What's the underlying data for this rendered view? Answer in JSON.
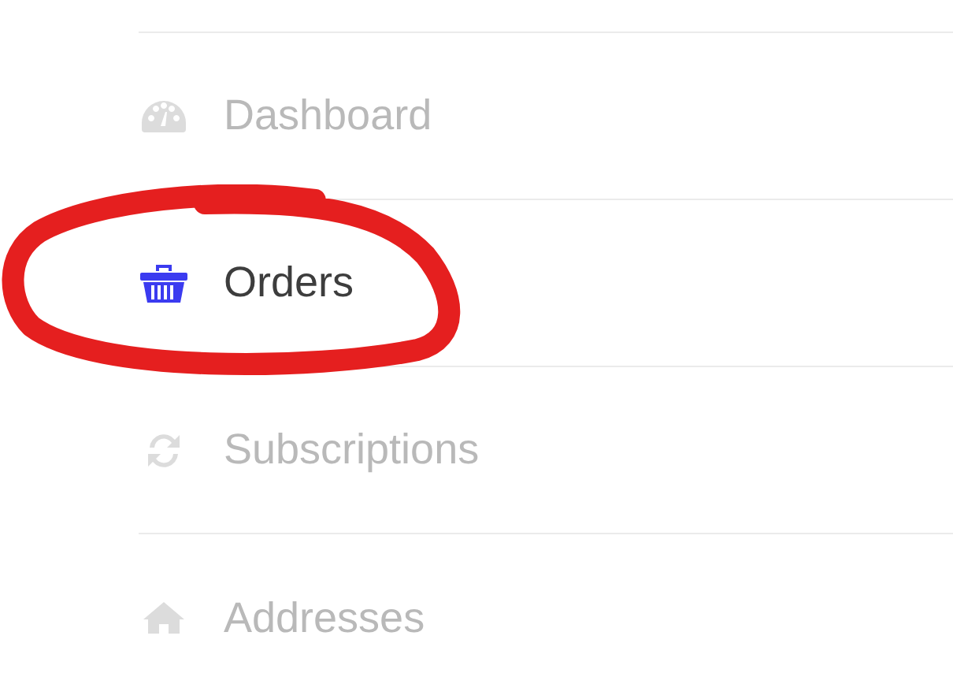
{
  "menu": {
    "items": [
      {
        "label": "Dashboard",
        "kind": "gauge",
        "selected": false,
        "circled": false
      },
      {
        "label": "Orders",
        "kind": "basket",
        "selected": true,
        "circled": true
      },
      {
        "label": "Subscriptions",
        "kind": "refresh",
        "selected": false,
        "circled": false
      },
      {
        "label": "Addresses",
        "kind": "house",
        "selected": false,
        "circled": false
      }
    ]
  }
}
